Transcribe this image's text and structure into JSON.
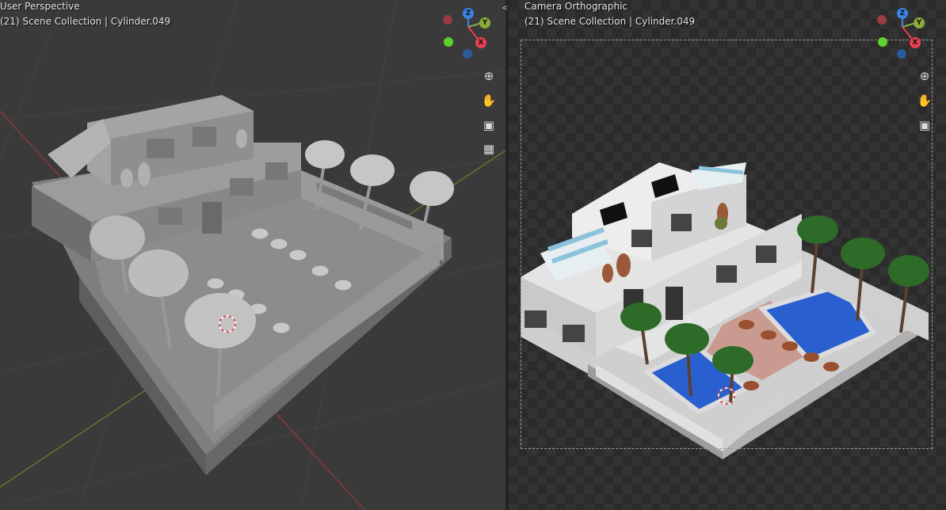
{
  "viewports": {
    "left": {
      "title": "User Perspective",
      "subtitle": "(21) Scene Collection | Cylinder.049",
      "shading": "solid",
      "nav_buttons": [
        "zoom-icon",
        "hand-icon",
        "camera-icon",
        "grid-icon"
      ]
    },
    "right": {
      "title": "Camera Orthographic",
      "subtitle": "(21) Scene Collection | Cylinder.049",
      "shading": "material-preview",
      "nav_buttons": [
        "zoom-icon",
        "hand-icon",
        "camera-icon"
      ]
    }
  },
  "gizmo": {
    "labels": {
      "z": "Z",
      "y": "Y",
      "x": "X"
    },
    "colors": {
      "x": "#e8404f",
      "y": "#8cab3a",
      "z": "#3b85e6"
    }
  },
  "divider_handle": "<>",
  "colors": {
    "viewport_bg": "#3a3a3a",
    "camera_bg": "#2b2b2b",
    "pool_water": "#1f4fc4",
    "palm_green": "#2e6b28",
    "tile_floor": "#c99a8f"
  }
}
